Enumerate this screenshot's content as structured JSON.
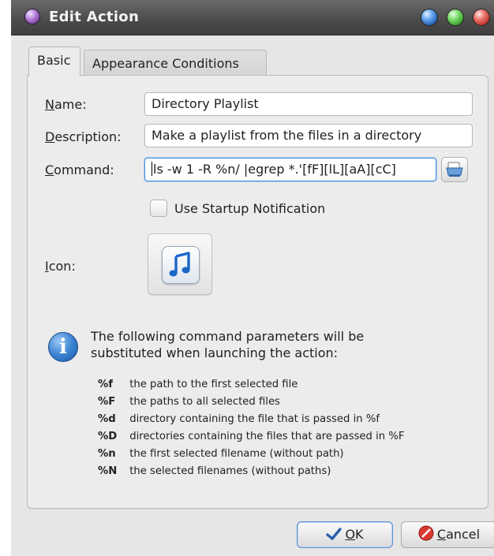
{
  "window": {
    "title": "Edit Action"
  },
  "tabs": [
    {
      "label": "Basic",
      "active": true
    },
    {
      "label": "Appearance Conditions",
      "active": false
    }
  ],
  "form": {
    "name_label_access": "N",
    "name_label_rest": "ame:",
    "name_value": "Directory Playlist",
    "description_label_access": "D",
    "description_label_rest": "escription:",
    "description_value": "Make a playlist from the files in a directory",
    "command_label_access": "C",
    "command_label_rest": "ommand:",
    "command_value": "ls -w 1 -R %n/ |egrep *.'[fF][lL][aA][cC]",
    "startup_notification_label": "Use Startup Notification",
    "startup_notification_checked": false,
    "icon_label_access": "I",
    "icon_label_rest": "con:"
  },
  "info": {
    "text": "The following command parameters will be substituted when launching the action:",
    "params": [
      {
        "key": "%f",
        "desc": "the path to the first selected file"
      },
      {
        "key": "%F",
        "desc": "the paths to all selected files"
      },
      {
        "key": "%d",
        "desc": "directory containing the file that is passed in %f"
      },
      {
        "key": "%D",
        "desc": "directories containing the files that are passed in %F"
      },
      {
        "key": "%n",
        "desc": "the first selected filename (without path)"
      },
      {
        "key": "%N",
        "desc": "the selected filenames (without paths)"
      }
    ]
  },
  "buttons": {
    "ok_access": "O",
    "ok_rest": "K",
    "cancel_access": "C",
    "cancel_rest": "ancel"
  },
  "icons": {
    "app": "app-icon",
    "browse": "open-file-icon",
    "action": "music-note-icon",
    "info": "info-icon",
    "ok": "checkmark-icon",
    "cancel": "cancel-icon"
  },
  "colors": {
    "titlebar": "#4a4a4a",
    "focus": "#4a90d9",
    "info": "#2a6fc4",
    "cancel": "#d93a2f"
  }
}
